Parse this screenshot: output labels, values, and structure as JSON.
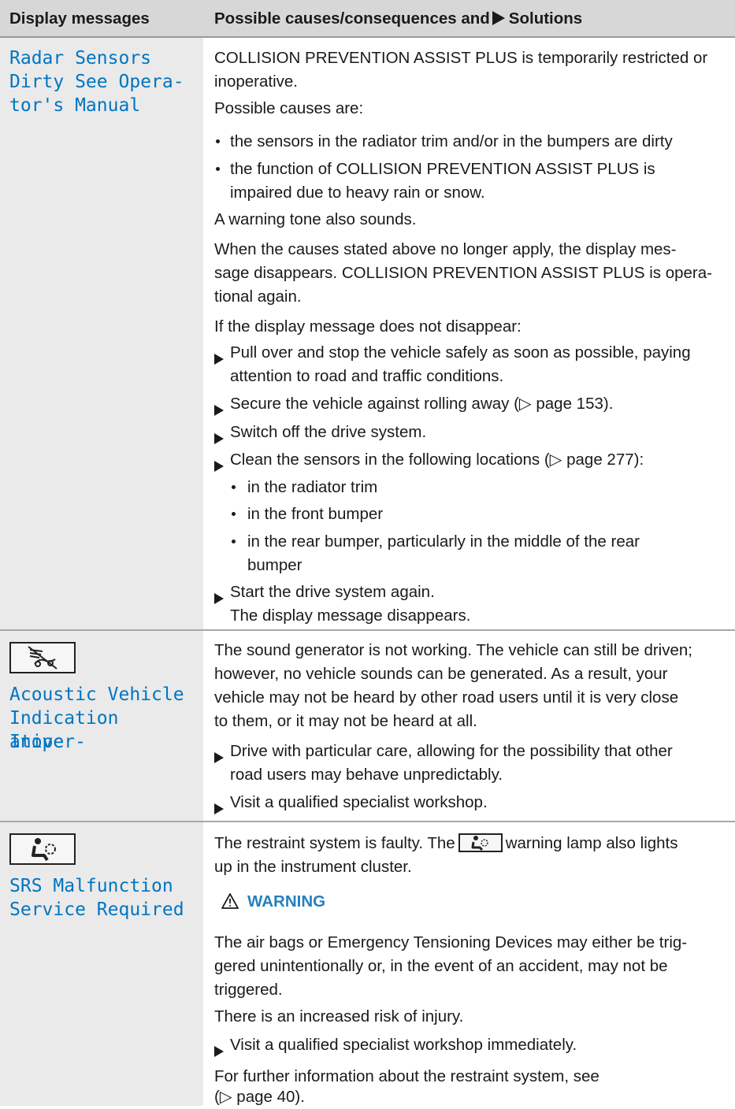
{
  "header": {
    "col_left": "Display messages",
    "col_right_pre": "Possible causes/consequences and",
    "col_right_post": "Solutions"
  },
  "rows": [
    {
      "message_lines": [
        "Radar Sensors",
        "Dirty See Opera-",
        "tor's Manual"
      ],
      "content": {
        "p1": [
          "COLLISION PREVENTION ASSIST PLUS is temporarily restricted or",
          "inoperative."
        ],
        "p2": "Possible causes are:",
        "bullet1": "the sensors in the radiator trim and/or in the bumpers are dirty",
        "bullet2": [
          "the function of COLLISION PREVENTION ASSIST PLUS is",
          "impaired due to heavy rain or snow."
        ],
        "p3": "A warning tone also sounds.",
        "p4": [
          "When the causes stated above no longer apply, the display mes-",
          "sage disappears. COLLISION PREVENTION ASSIST PLUS is opera-",
          "tional again."
        ],
        "p5": "If the display message does not disappear:",
        "step1": [
          "Pull over and stop the vehicle safely as soon as possible, paying",
          "attention to road and traffic conditions."
        ],
        "step2": "Secure the vehicle against rolling away (▷ page 153).",
        "step3": "Switch off the drive system.",
        "step4": "Clean the sensors in the following locations (▷ page 277):",
        "sub1": "in the radiator trim",
        "sub2": "in the front bumper",
        "sub3": [
          "in the rear bumper, particularly in the middle of the rear",
          "bumper"
        ],
        "step5": "Start the drive system again.",
        "step5_result": "The display message disappears."
      }
    },
    {
      "icon": "sound-generator-off-icon",
      "message_lines": [
        "Acoustic Vehicle",
        "Indication Inoper-",
        "ative"
      ],
      "content": {
        "p1": [
          "The sound generator is not working. The vehicle can still be driven;",
          "however, no vehicle sounds can be generated. As a result, your",
          "vehicle may not be heard by other road users until it is very close",
          "to them, or it may not be heard at all."
        ],
        "step1": [
          "Drive with particular care, allowing for the possibility that other",
          "road users may behave unpredictably."
        ],
        "step2": "Visit a qualified specialist workshop."
      }
    },
    {
      "icon": "airbag-warning-icon",
      "message_lines": [
        "SRS Malfunction",
        "Service Required"
      ],
      "content": {
        "p1_pre": "The restraint system is faulty. The",
        "p1_post": "warning lamp also lights",
        "p1_line2": "up in the instrument cluster.",
        "warning_title": "WARNING",
        "warn_text": [
          "The air bags or Emergency Tensioning Devices may either be trig-",
          "gered unintentionally or, in the event of an accident, may not be",
          "triggered."
        ],
        "warn_text2": "There is an increased risk of injury.",
        "step1": "Visit a qualified specialist workshop immediately.",
        "p_last": [
          "For further information about the restraint system, see",
          "(▷ page 40)."
        ]
      }
    }
  ],
  "colors": {
    "accent": "#0075c0",
    "warning": "#2680bd",
    "header_bg": "#d7d7d7",
    "left_bg": "#eaeaea"
  }
}
